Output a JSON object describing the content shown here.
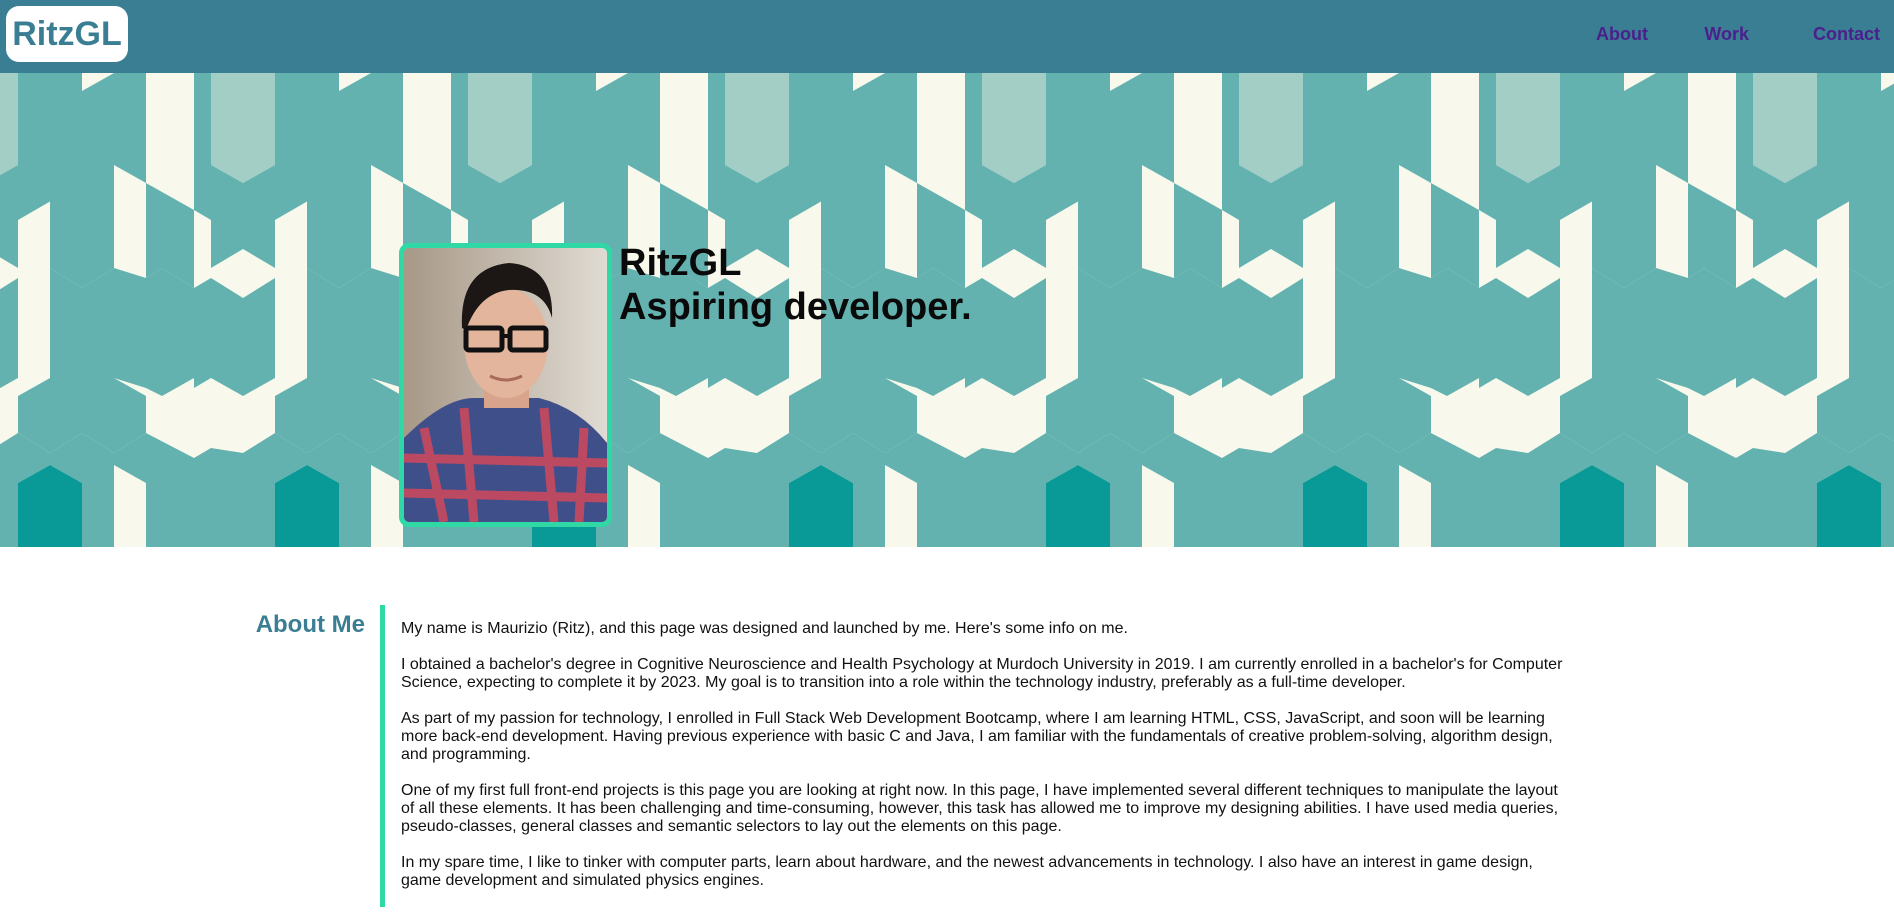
{
  "header": {
    "logo": "RitzGL",
    "nav": [
      {
        "label": "About"
      },
      {
        "label": "Work"
      },
      {
        "label": "Contact"
      }
    ]
  },
  "hero": {
    "name": "RitzGL",
    "tagline": "Aspiring developer."
  },
  "about": {
    "heading": "About Me",
    "paragraphs": [
      "My name is Maurizio (Ritz), and this page was designed and launched by me. Here's some info on me.",
      "I obtained a bachelor's degree in Cognitive Neuroscience and Health Psychology at Murdoch University in 2019. I am currently enrolled in a bachelor's for Computer Science, expecting to complete it by 2023. My goal is to transition into a role within the technology industry, preferably as a full-time developer.",
      "As part of my passion for technology, I enrolled in Full Stack Web Development Bootcamp, where I am learning HTML, CSS, JavaScript, and soon will be learning more back-end development. Having previous experience with basic C and Java, I am familiar with the fundamentals of creative problem-solving, algorithm design, and programming.",
      "One of my first full front-end projects is this page you are looking at right now. In this page, I have implemented several different techniques to manipulate the layout of all these elements. It has been challenging and time-consuming, however, this task has allowed me to improve my designing abilities. I have used media queries, pseudo-classes, general classes and semantic selectors to lay out the elements on this page.",
      "In my spare time, I like to tinker with computer parts, learn about hardware, and the newest advancements in technology. I also have an interest in game design, game development and simulated physics engines."
    ]
  },
  "colors": {
    "header_bg": "#3a7e93",
    "accent": "#2fd8a5",
    "nav_link": "#4b1f8c",
    "pattern_teal": "#63b2b0",
    "pattern_light": "#a3cec6",
    "pattern_dark": "#099a98",
    "pattern_bg": "#f8f9ec"
  }
}
